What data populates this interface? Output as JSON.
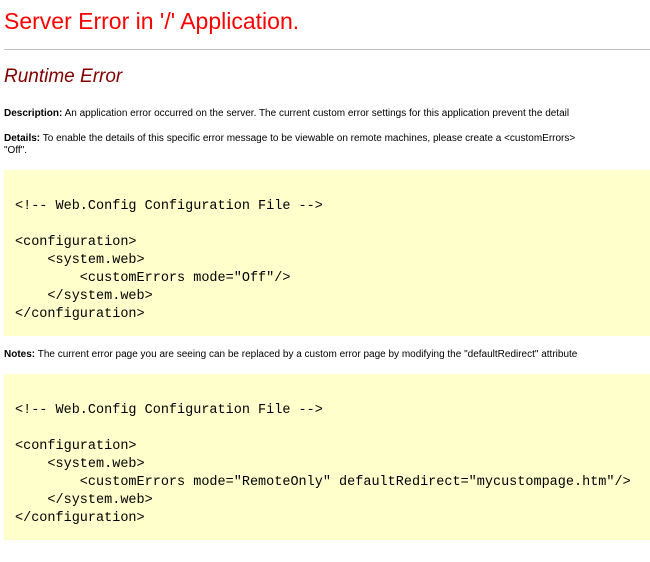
{
  "app_title": "Server Error in '/' Application.",
  "error_title": "Runtime Error",
  "description": {
    "label": "Description:",
    "text": "An application error occurred on the server. The current custom error settings for this application prevent the detail"
  },
  "details": {
    "label": "Details:",
    "text": "To enable the details of this specific error message to be viewable on remote machines, please create a <customErrors>",
    "text_line2": "\"Off\"."
  },
  "code_block_1": {
    "lines": [
      "<!-- Web.Config Configuration File -->",
      "<configuration>",
      "    <system.web>",
      "        <customErrors mode=\"Off\"/>",
      "    </system.web>",
      "</configuration>"
    ]
  },
  "notes": {
    "label": "Notes:",
    "text": "The current error page you are seeing can be replaced by a custom error page by modifying the \"defaultRedirect\" attribute"
  },
  "code_block_2": {
    "lines": [
      "<!-- Web.Config Configuration File -->",
      "<configuration>",
      "    <system.web>",
      "        <customErrors mode=\"RemoteOnly\" defaultRedirect=\"mycustompage.htm\"/>",
      "    </system.web>",
      "</configuration>"
    ]
  },
  "colors": {
    "title": "#ff0000",
    "subtitle": "#800000",
    "code_background": "#ffffcc",
    "rule": "#c0c0c0"
  }
}
